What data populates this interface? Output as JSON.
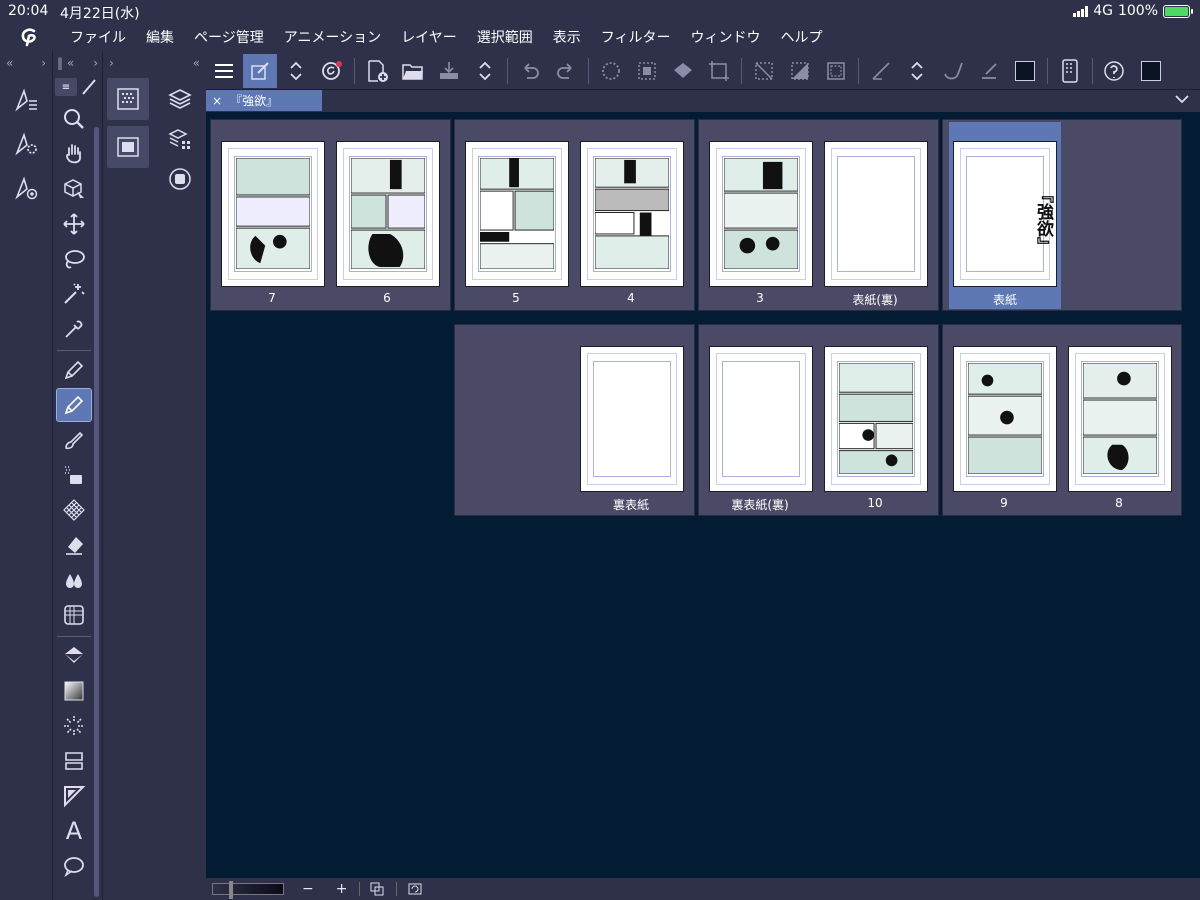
{
  "status": {
    "time": "20:04",
    "date": "4月22日(水)",
    "network": "4G",
    "battery": "100%"
  },
  "menu": [
    "ファイル",
    "編集",
    "ページ管理",
    "アニメーション",
    "レイヤー",
    "選択範囲",
    "表示",
    "フィルター",
    "ウィンドウ",
    "ヘルプ"
  ],
  "panel_headers": {
    "col1": [
      "«",
      "›"
    ],
    "col2": [
      "‖ «",
      "›"
    ],
    "col3": [
      "›",
      "«"
    ]
  },
  "document": {
    "tab_title": "『強欲』",
    "close": "×"
  },
  "pages_row1": [
    {
      "label": "7",
      "type": "manga"
    },
    {
      "label": "6",
      "type": "manga"
    },
    {
      "label": "5",
      "type": "manga"
    },
    {
      "label": "4",
      "type": "manga"
    },
    {
      "label": "3",
      "type": "manga"
    },
    {
      "label": "表紙(裏)",
      "type": "blank"
    },
    {
      "label": "表紙",
      "type": "cover",
      "selected": true,
      "cover_title": "『強欲』"
    }
  ],
  "pages_row2": [
    {
      "label": "裏表紙",
      "type": "blank"
    },
    {
      "label": "裏表紙(裏)",
      "type": "blank"
    },
    {
      "label": "10",
      "type": "manga"
    },
    {
      "label": "9",
      "type": "manga"
    },
    {
      "label": "8",
      "type": "manga"
    }
  ],
  "bottom": {
    "zoom_out": "−",
    "zoom_in": "+"
  },
  "colors": {
    "accent": "#5d78b5",
    "panel": "#2e3149",
    "canvas": "#031c34",
    "spread": "#4a4a66"
  }
}
